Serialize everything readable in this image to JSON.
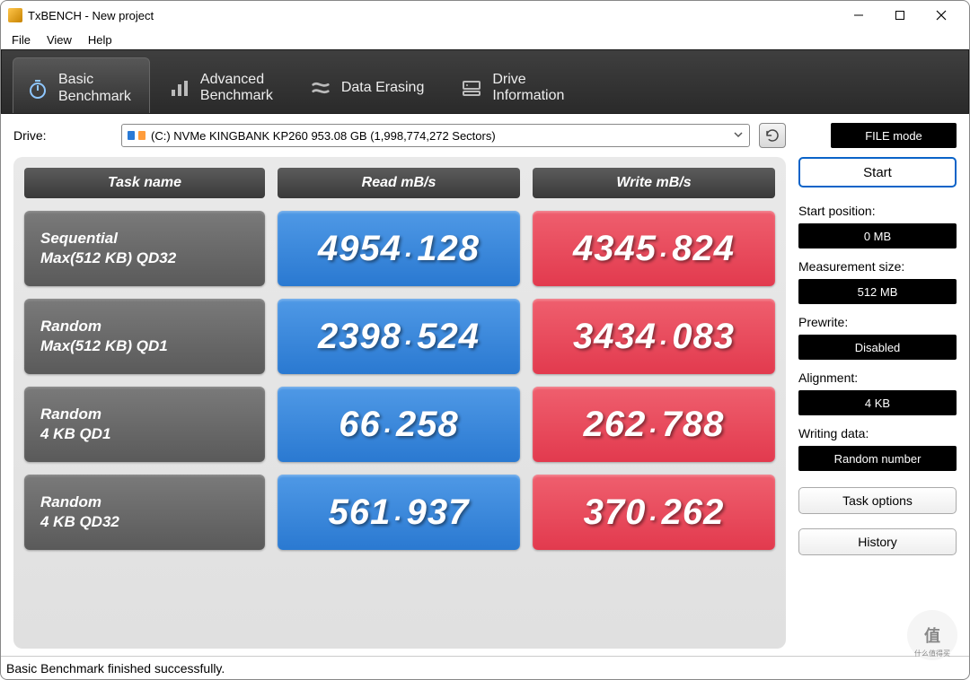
{
  "window": {
    "title": "TxBENCH - New project"
  },
  "menu": {
    "file": "File",
    "view": "View",
    "help": "Help"
  },
  "tabs": {
    "basic": {
      "l1": "Basic",
      "l2": "Benchmark"
    },
    "advanced": {
      "l1": "Advanced",
      "l2": "Benchmark"
    },
    "erase": {
      "l1": "Data Erasing"
    },
    "info": {
      "l1": "Drive",
      "l2": "Information"
    }
  },
  "drive": {
    "label": "Drive:",
    "value": "(C:) NVMe KINGBANK KP260  953.08 GB (1,998,774,272 Sectors)"
  },
  "filemode": "FILE mode",
  "headers": {
    "task": "Task name",
    "read": "Read mB/s",
    "write": "Write mB/s"
  },
  "rows": [
    {
      "t1": "Sequential",
      "t2": "Max(512 KB) QD32",
      "read": "4954.128",
      "write": "4345.824"
    },
    {
      "t1": "Random",
      "t2": "Max(512 KB) QD1",
      "read": "2398.524",
      "write": "3434.083"
    },
    {
      "t1": "Random",
      "t2": "4 KB QD1",
      "read": "66.258",
      "write": "262.788"
    },
    {
      "t1": "Random",
      "t2": "4 KB QD32",
      "read": "561.937",
      "write": "370.262"
    }
  ],
  "side": {
    "start": "Start",
    "startpos_lbl": "Start position:",
    "startpos_val": "0 MB",
    "msize_lbl": "Measurement size:",
    "msize_val": "512 MB",
    "prewrite_lbl": "Prewrite:",
    "prewrite_val": "Disabled",
    "align_lbl": "Alignment:",
    "align_val": "4 KB",
    "wdata_lbl": "Writing data:",
    "wdata_val": "Random number",
    "taskopt": "Task options",
    "history": "History"
  },
  "status": "Basic Benchmark finished successfully.",
  "watermark": {
    "main": "值",
    "sub": "什么值得买"
  }
}
